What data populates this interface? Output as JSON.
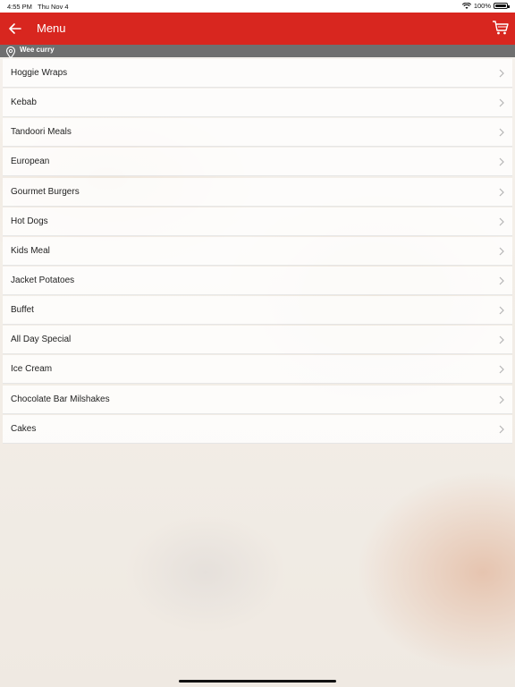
{
  "status_bar": {
    "time": "4:55 PM",
    "date": "Thu Nov 4",
    "battery": "100%"
  },
  "header": {
    "title": "Menu",
    "back_icon": "arrow-left-icon",
    "cart_icon": "cart-icon"
  },
  "location": {
    "name": "Wee curry",
    "icon": "location-pin-icon"
  },
  "menu": {
    "items": [
      {
        "label": "Hoggie Wraps"
      },
      {
        "label": "Kebab"
      },
      {
        "label": "Tandoori Meals"
      },
      {
        "label": "European"
      },
      {
        "label": "Gourmet Burgers"
      },
      {
        "label": "Hot Dogs"
      },
      {
        "label": "Kids Meal"
      },
      {
        "label": "Jacket Potatoes"
      },
      {
        "label": "Buffet"
      },
      {
        "label": "All Day Special"
      },
      {
        "label": "Ice Cream"
      },
      {
        "label": "Chocolate Bar Milshakes"
      },
      {
        "label": "Cakes"
      }
    ]
  },
  "colors": {
    "header": "#d8261f",
    "location_bar": "#6f6f6f"
  }
}
